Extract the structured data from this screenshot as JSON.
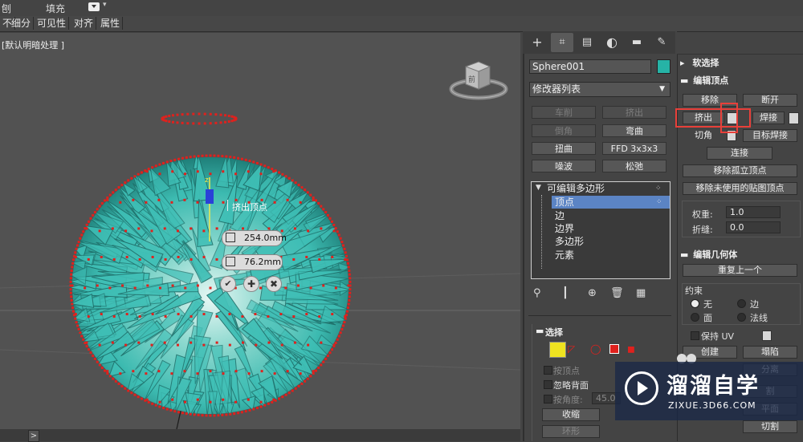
{
  "top_bar": {
    "item_1": "刨",
    "item_2": "填充"
  },
  "ribbon_tabs": [
    "不",
    "细分",
    "可见性",
    "对齐",
    "属性"
  ],
  "viewport": {
    "label": "[默认明暗处理 ]",
    "viewcube_face": "前",
    "caddy": {
      "title": "挤出顶点",
      "height_value": "254.0mm",
      "width_value": "76.2mm"
    },
    "colors": {
      "mesh": "#3fbfb6",
      "vertex": "#e0211d",
      "background": "#525252"
    }
  },
  "command_panel": {
    "object_name": "Sphere001",
    "object_color": "#26b3a6",
    "modifier_list": "修改器列表",
    "modifier_buttons": [
      {
        "label": "车削",
        "enabled": false
      },
      {
        "label": "挤出",
        "enabled": false
      },
      {
        "label": "倒角",
        "enabled": false
      },
      {
        "label": "弯曲",
        "enabled": true
      },
      {
        "label": "扭曲",
        "enabled": true
      },
      {
        "label": "FFD 3x3x3",
        "enabled": true
      },
      {
        "label": "噪波",
        "enabled": true
      },
      {
        "label": "松弛",
        "enabled": true
      }
    ],
    "stack": {
      "root": "可编辑多边形",
      "items": [
        "顶点",
        "边",
        "边界",
        "多边形",
        "元素"
      ],
      "selected": "顶点"
    },
    "selection": {
      "title": "选择",
      "by_vertex": "按顶点",
      "ignore_backfacing": "忽略背面",
      "by_angle": "按角度:",
      "angle_value": "45.0",
      "shrink": "收缩",
      "ring": "环形"
    }
  },
  "rollouts": {
    "soft_selection": "软选择",
    "edit_vertices": {
      "title": "编辑顶点",
      "remove": "移除",
      "break": "断开",
      "extrude": "挤出",
      "weld": "焊接",
      "chamfer": "切角",
      "target_weld": "目标焊接",
      "connect": "连接",
      "remove_isolated": "移除孤立顶点",
      "remove_unused_map": "移除未使用的贴图顶点",
      "weight_label": "权重:",
      "weight_value": "1.0",
      "crease_label": "折缝:",
      "crease_value": "0.0"
    },
    "edit_geometry": {
      "title": "编辑几何体",
      "repeat_last": "重复上一个",
      "constraints": "约束",
      "none": "无",
      "edge": "边",
      "face": "面",
      "normal": "法线",
      "preserve_uv": "保持 UV",
      "create": "创建",
      "collapse": "塌陷",
      "detach": "分离",
      "slice_plane_partial": "割",
      "slice_plane_partial2": "平面",
      "cut": "切割"
    }
  },
  "watermark": {
    "brand": "溜溜自学",
    "url": "ZIXUE.3D66.COM"
  }
}
